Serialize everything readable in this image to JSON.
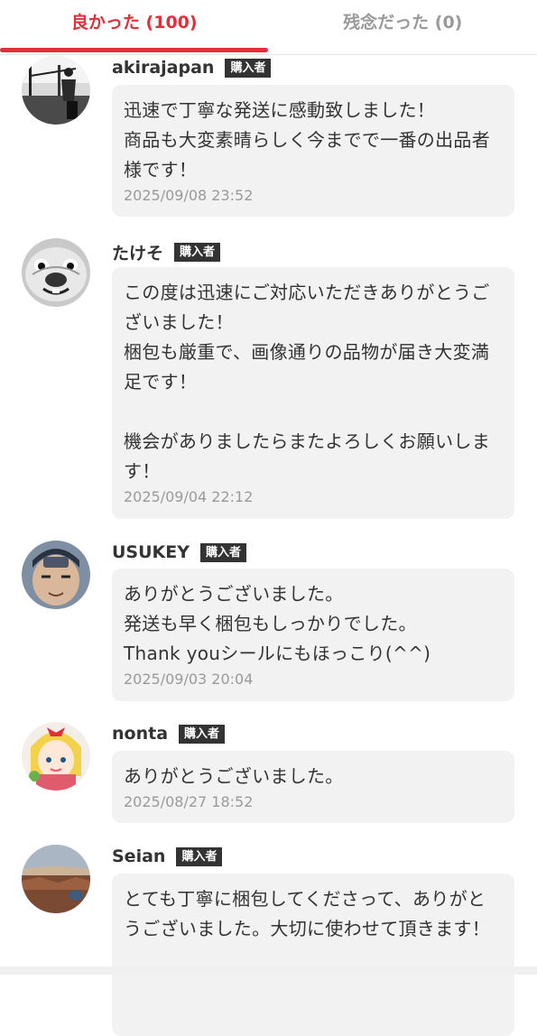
{
  "tabs": {
    "good": "良かった (100)",
    "bad": "残念だった (0)"
  },
  "badge_label": "購入者",
  "reviews": [
    {
      "username": "akirajapan",
      "comment": "迅速で丁寧な発送に感動致しました！\n商品も大変素晴らしく今までで一番の出品者様です！",
      "date": "2025/09/08 23:52"
    },
    {
      "username": "たけそ",
      "comment": "この度は迅速にご対応いただきありがとうございました！\n梱包も厳重で、画像通りの品物が届き大変満足です！\n\n機会がありましたらまたよろしくお願いします！",
      "date": "2025/09/04 22:12"
    },
    {
      "username": "USUKEY",
      "comment": "ありがとうございました。\n発送も早く梱包もしっかりでした。\nThank youシールにもほっこり(^^)",
      "date": "2025/09/03 20:04"
    },
    {
      "username": "nonta",
      "comment": "ありがとうございました。",
      "date": "2025/08/27 18:52"
    },
    {
      "username": "Seian",
      "comment": "とても丁寧に梱包してくださって、ありがとうございました。大切に使わせて頂きます！",
      "date": ""
    }
  ]
}
